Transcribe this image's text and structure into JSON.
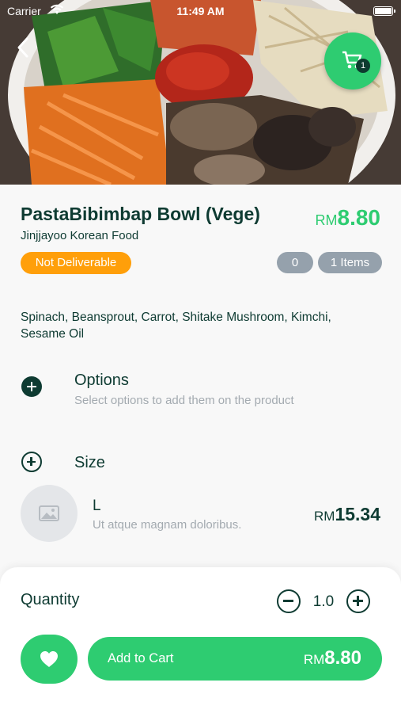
{
  "status_bar": {
    "carrier": "Carrier",
    "time": "11:49 AM"
  },
  "cart": {
    "badge_count": "1"
  },
  "product": {
    "name": "PastaBibimbap Bowl (Vege)",
    "vendor": "Jinjjayoo Korean Food",
    "currency": "RM",
    "price": "8.80",
    "delivery_status": "Not Deliverable",
    "stock_count": "0",
    "items_label": "1 Items",
    "ingredients": "Spinach, Beansprout, Carrot, Shitake Mushroom, Kimchi, Sesame Oil"
  },
  "options": {
    "title": "Options",
    "subtitle": "Select options to add them on the product"
  },
  "size": {
    "title": "Size",
    "variant": {
      "name": "L",
      "description": "Ut atque magnam doloribus.",
      "currency": "RM",
      "price": "15.34"
    }
  },
  "quantity": {
    "label": "Quantity",
    "value": "1.0"
  },
  "add_to_cart": {
    "label": "Add to Cart",
    "currency": "RM",
    "price": "8.80"
  },
  "colors": {
    "accent": "#2ecc71",
    "dark": "#0e3b32",
    "warning": "#ff9f0a",
    "muted_pill": "#95a1ac"
  }
}
